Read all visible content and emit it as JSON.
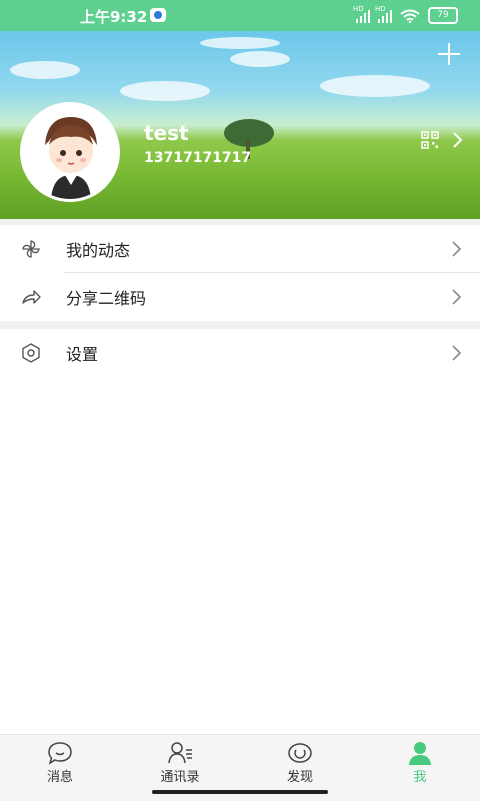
{
  "status_bar": {
    "time": "上午9:32",
    "sim1_label": "HD",
    "sim2_label": "HD",
    "battery": "79",
    "icons": [
      "notification-app-icon",
      "signal-icon",
      "signal-icon",
      "wifi-icon",
      "battery-icon"
    ]
  },
  "profile": {
    "username": "test",
    "phone": "13717171717",
    "avatar_icon": "cartoon-avatar",
    "add_icon": "plus-icon",
    "qr_icon": "qr-code-icon",
    "chevron_icon": "chevron-right-icon"
  },
  "menu": [
    {
      "label": "我的动态",
      "icon": "pinwheel-icon"
    },
    {
      "label": "分享二维码",
      "icon": "share-icon"
    },
    {
      "label": "设置",
      "icon": "hexagon-settings-icon"
    }
  ],
  "tabbar": {
    "active_color": "#47c97f",
    "items": [
      {
        "label": "消息",
        "icon": "chat-bubble-icon"
      },
      {
        "label": "通讯录",
        "icon": "contacts-icon"
      },
      {
        "label": "发现",
        "icon": "discover-icon"
      },
      {
        "label": "我",
        "icon": "person-icon",
        "active": true
      }
    ]
  },
  "colors": {
    "status_bar": "#5dd08f",
    "accent": "#47c97f",
    "section_gap": "#f0f0f0"
  }
}
